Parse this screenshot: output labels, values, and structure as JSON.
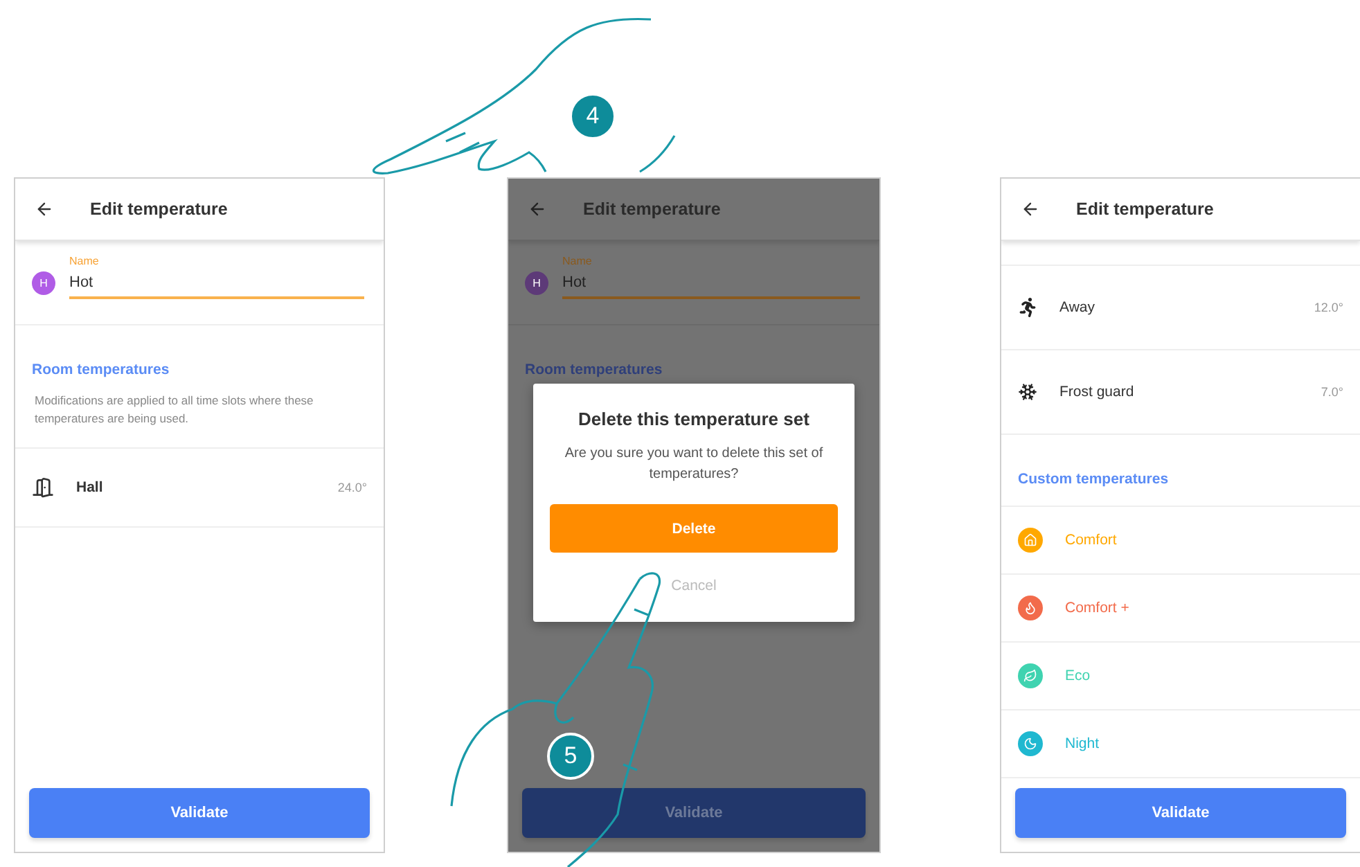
{
  "screens": [
    {
      "kind": "edit",
      "dimmed": false,
      "title": "Edit temperature",
      "name_label": "Name",
      "avatar": "H",
      "name_value": "Hot",
      "section": "Room temperatures",
      "note": "Modifications are applied to all time slots where these temperatures are being used.",
      "rows": [
        {
          "label": "Hall",
          "value": "24.0°"
        }
      ],
      "button": "Validate"
    },
    {
      "kind": "edit",
      "dimmed": true,
      "title": "Edit temperature",
      "name_label": "Name",
      "avatar": "H",
      "name_value": "Hot",
      "section": "Room temperatures",
      "button": "Validate",
      "dialog": {
        "title": "Delete this temperature set",
        "message": "Are you sure you want to delete this set of temperatures?",
        "confirm": "Delete",
        "cancel": "Cancel"
      }
    },
    {
      "kind": "modes",
      "dimmed": false,
      "title": "Edit temperature",
      "modes": [
        {
          "kind": "away",
          "label": "Away",
          "value": "12.0°"
        },
        {
          "kind": "frost",
          "label": "Frost guard",
          "value": "7.0°"
        }
      ],
      "section": "Custom temperatures",
      "custom": [
        {
          "kind": "comfort",
          "label": "Comfort",
          "color": "#ffa800"
        },
        {
          "kind": "comfortplus",
          "label": "Comfort +",
          "color": "#f26b4b"
        },
        {
          "kind": "eco",
          "label": "Eco",
          "color": "#3fd3b0"
        },
        {
          "kind": "night",
          "label": "Night",
          "color": "#1fb8d0"
        }
      ],
      "button": "Validate"
    }
  ],
  "steps": [
    {
      "number": "4"
    },
    {
      "number": "5"
    }
  ]
}
